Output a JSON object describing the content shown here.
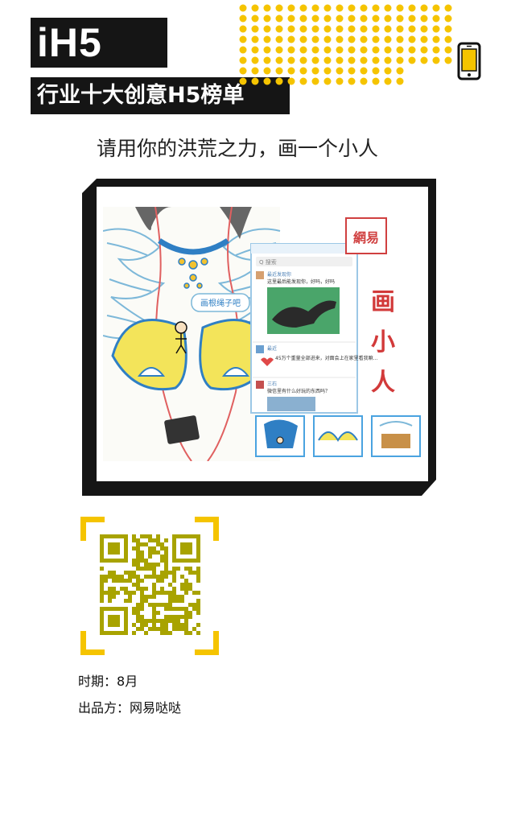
{
  "brand": {
    "logo": "iH5",
    "ribbon": "行业十大创意H5榜单"
  },
  "headline": "请用你的洪荒之力，画一个小人",
  "artwork": {
    "bubble_text": "画根绳子吧",
    "seal_text": "網易",
    "side_title": [
      "画",
      "小",
      "人"
    ],
    "search_placeholder": "Q 搜索",
    "posts": [
      {
        "user": "最近发现你",
        "text": "这里最后能发现你，好吗，好吗"
      },
      {
        "user": "最近",
        "text": "45万个重量全部进来，对面会上在家里看我嘛..."
      },
      {
        "user": "三石",
        "text": "微信里有什么好玩的东西吗？"
      }
    ]
  },
  "colors": {
    "accent_yellow": "#f5c400",
    "qr_olive": "#a8a300",
    "frame": "#151515"
  },
  "meta": [
    {
      "label": "时期",
      "value": "8月"
    },
    {
      "label": "出品方",
      "value": "网易哒哒"
    }
  ],
  "meta_sep": "："
}
